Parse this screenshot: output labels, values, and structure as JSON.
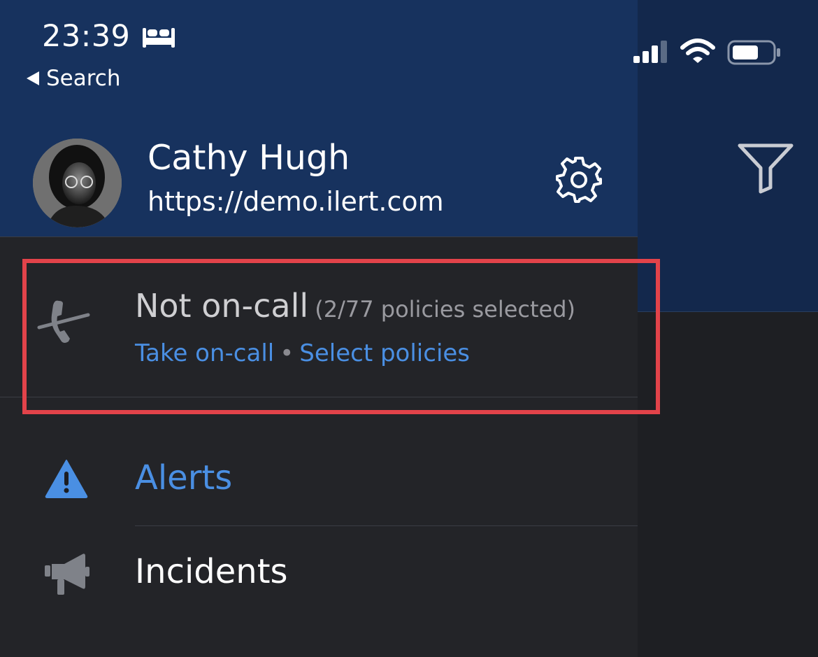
{
  "status_bar": {
    "time": "23:39",
    "back_label": "Search",
    "icons": [
      "bed-icon",
      "signal-icon",
      "wifi-icon",
      "battery-icon"
    ]
  },
  "profile": {
    "name": "Cathy Hugh",
    "url": "https://demo.ilert.com",
    "settings_icon": "gear-icon"
  },
  "oncall": {
    "status": "Not on-call",
    "policies_count": "(2/77 policies selected)",
    "take_oncall_link": "Take on-call",
    "separator": "•",
    "select_policies_link": "Select policies",
    "icon": "phone-off-icon"
  },
  "menu": {
    "items": [
      {
        "label": "Alerts",
        "icon": "alert-triangle-icon",
        "active": true
      },
      {
        "label": "Incidents",
        "icon": "megaphone-icon",
        "active": false
      }
    ]
  },
  "background_screen": {
    "icon": "filter-icon"
  },
  "colors": {
    "header_blue": "#17325e",
    "drawer_bg": "#232428",
    "accent_blue": "#4a8fe3",
    "highlight_red": "#e2434a"
  }
}
